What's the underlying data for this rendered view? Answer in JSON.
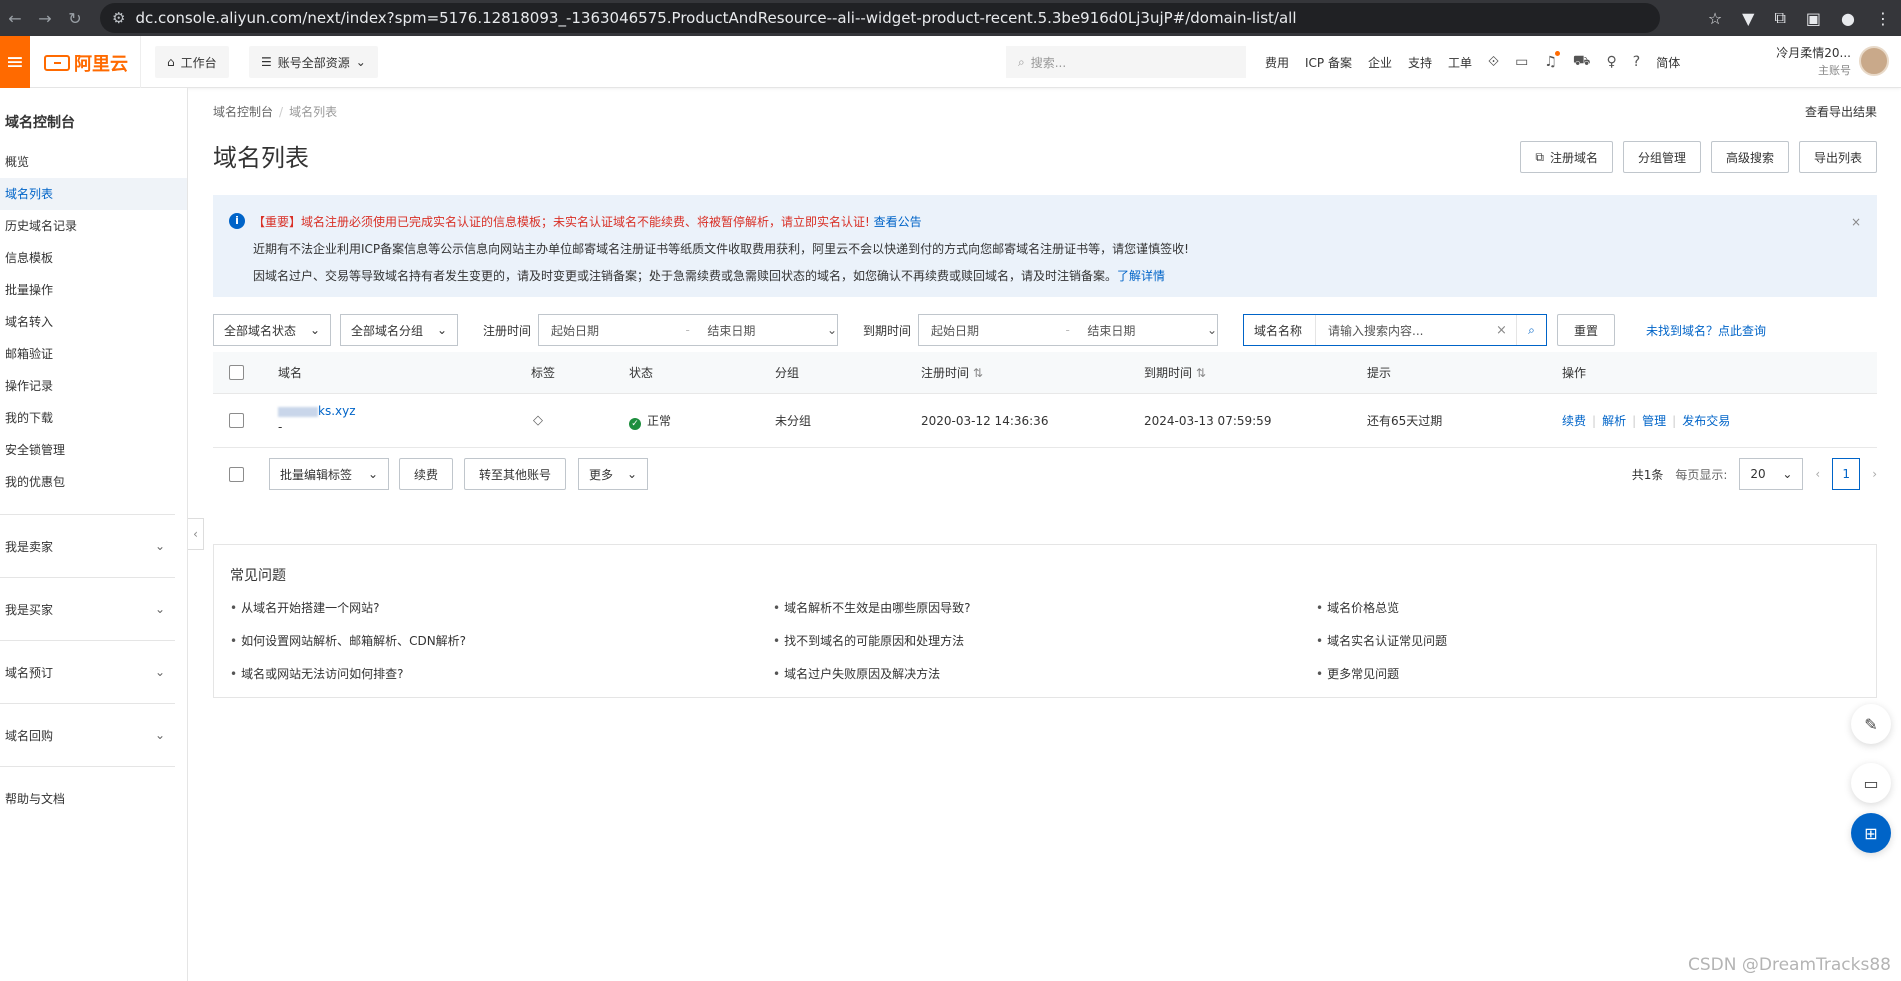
{
  "browser": {
    "url": "dc.console.aliyun.com/next/index?spm=5176.12818093_-1363046575.ProductAndResource--ali--widget-product-recent.5.3be916d0Lj3ujP#/domain-list/all"
  },
  "topnav": {
    "logo": "阿里云",
    "workbench": "工作台",
    "resources": "账号全部资源",
    "search_placeholder": "搜索...",
    "links": [
      "费用",
      "ICP 备案",
      "企业",
      "支持",
      "工单"
    ],
    "lang": "简体",
    "user_name": "冷月柔情20...",
    "user_role": "主账号"
  },
  "sidebar": {
    "title": "域名控制台",
    "items": [
      "概览",
      "域名列表",
      "历史域名记录",
      "信息模板",
      "批量操作",
      "域名转入",
      "邮箱验证",
      "操作记录",
      "我的下载",
      "安全锁管理",
      "我的优惠包"
    ],
    "groups": [
      "我是卖家",
      "我是买家",
      "域名预订",
      "域名回购"
    ],
    "help": "帮助与文档"
  },
  "main": {
    "breadcrumb": [
      "域名控制台",
      "域名列表"
    ],
    "export_results": "查看导出结果",
    "title": "域名列表",
    "buttons": [
      "注册域名",
      "分组管理",
      "高级搜索",
      "导出列表"
    ],
    "notice": {
      "line1_red": "【重要】域名注册必须使用已完成实名认证的信息模板；未实名认证域名不能续费、将被暂停解析，请立即实名认证!",
      "line1_link": "查看公告",
      "line2": "近期有不法企业利用ICP备案信息等公示信息向网站主办单位邮寄域名注册证书等纸质文件收取费用获利，阿里云不会以快递到付的方式向您邮寄域名注册证书等，请您谨慎签收!",
      "line3": "因域名过户、交易等导致域名持有者发生变更的，请及时变更或注销备案；处于急需续费或急需赎回状态的域名，如您确认不再续费或赎回域名，请及时注销备案。",
      "line3_link": "了解详情"
    },
    "filters": {
      "status": "全部域名状态",
      "group": "全部域名分组",
      "reg_label": "注册时间",
      "exp_label": "到期时间",
      "start_date": "起始日期",
      "end_date": "结束日期",
      "search_key": "域名名称",
      "search_placeholder": "请输入搜索内容...",
      "reset": "重置",
      "not_found": "未找到域名？点此查询"
    },
    "table": {
      "headers": [
        "域名",
        "标签",
        "状态",
        "分组",
        "注册时间",
        "到期时间",
        "提示",
        "操作"
      ],
      "row": {
        "domain": "ks.xyz",
        "domain_sub": "-",
        "status": "正常",
        "group": "未分组",
        "reg_time": "2020-03-12 14:36:36",
        "exp_time": "2024-03-13 07:59:59",
        "tip": "还有65天过期",
        "ops": [
          "续费",
          "解析",
          "管理",
          "发布交易"
        ]
      }
    },
    "bulk": {
      "tag": "批量编辑标签",
      "renew": "续费",
      "transfer": "转至其他账号",
      "more": "更多"
    },
    "pager": {
      "total": "共1条",
      "per_page_label": "每页显示:",
      "per_page": "20",
      "page": "1"
    },
    "faq": {
      "title": "常见问题",
      "items": [
        "从域名开始搭建一个网站?",
        "域名解析不生效是由哪些原因导致?",
        "域名价格总览",
        "如何设置网站解析、邮箱解析、CDN解析?",
        "找不到域名的可能原因和处理方法",
        "域名实名认证常见问题",
        "域名或网站无法访问如何排查?",
        "域名过户失败原因及解决方法",
        "更多常见问题"
      ]
    }
  },
  "watermark": "CSDN @DreamTracks88"
}
